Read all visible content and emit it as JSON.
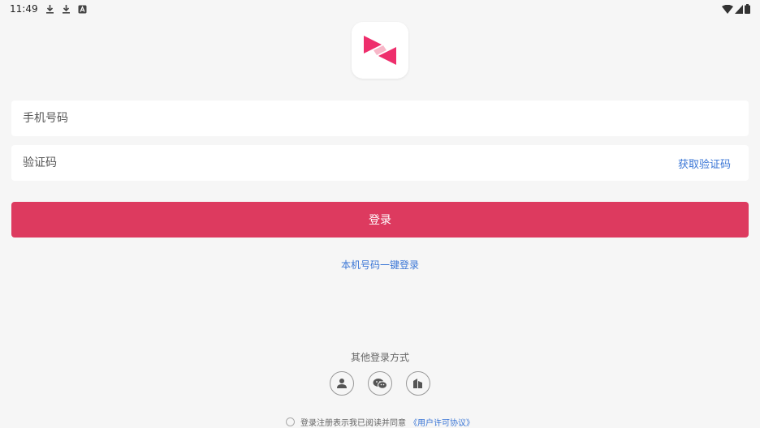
{
  "status_bar": {
    "time": "11:49",
    "left_icons": [
      "download-icon",
      "download-icon",
      "text-icon"
    ],
    "right_icons": [
      "wifi-icon",
      "signal-icon",
      "battery-icon"
    ]
  },
  "logo": {
    "icon": "app-logo",
    "colors": {
      "primary": "#ee2e6c",
      "secondary": "#f7b7c8"
    }
  },
  "form": {
    "phone_placeholder": "手机号码",
    "code_placeholder": "验证码",
    "get_code_label": "获取验证码",
    "login_label": "登录",
    "onekey_label": "本机号码一键登录"
  },
  "other_login": {
    "title": "其他登录方式",
    "methods": [
      "user-icon",
      "wechat-icon",
      "weibo-icon"
    ]
  },
  "agreement": {
    "text": "登录注册表示我已阅读并同意",
    "link": "《用户许可协议》"
  },
  "colors": {
    "accent": "#dd3a5f",
    "link": "#3a76d6",
    "background": "#f6f6f6"
  }
}
